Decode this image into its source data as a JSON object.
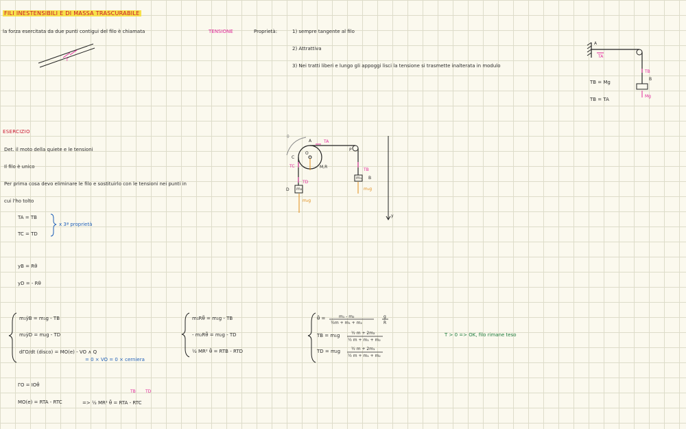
{
  "title": "FILI INESTENSIBILI E DI MASSA TRASCURABILE",
  "intro": {
    "text": "la forza esercitata da due punti contigui del filo è chiamata",
    "keyword": "TENSIONE",
    "props_label": "Proprietà:",
    "props": [
      "1) sempre tangente al filo",
      "2) Attrattiva",
      "3) Nei tratti liberi e lungo gli appoggi lisci la tensione si trasmette inalterata in modulo"
    ]
  },
  "diagram1": {
    "t": "T"
  },
  "diagram2": {
    "A": "A",
    "TA": "TA",
    "TB": "TB",
    "B": "B",
    "Mg": "Mg",
    "eq1": "TB = Mg",
    "eq2": "TB = TA"
  },
  "exercise": {
    "title": "ESERCIZIO",
    "lines": [
      "Det. il moto della quiete e le tensioni",
      "Il filo è unico",
      "Per prima cosa devo eliminare le filo e sostituirlo con le tensioni nei punti in",
      "cui l'ho tolto"
    ],
    "eqs": [
      "TA = TB",
      "TC = TD"
    ],
    "note": "x 3ª proprietà",
    "yb": "yB = Rθ",
    "yd": "yD = - Rθ"
  },
  "diagram3": {
    "A": "A",
    "C": "C",
    "O": "O",
    "P": "P",
    "D": "D",
    "B": "B",
    "TA": "TA",
    "TC": "TC",
    "TB": "TB",
    "TD": "TD",
    "MR": "M,R",
    "m1": "m₁",
    "m2": "m₂",
    "m1g": "m₁g",
    "m2g": "m₂g",
    "y": "y",
    "theta": "θ"
  },
  "system1": [
    "m₁ÿB = m₁g - TB",
    "m₂ÿD = m₂g - TD",
    "dΓO/dt (disco) = MO(e) - VO ∧ Q",
    "= 0 × VO = 0 × cerniera"
  ],
  "system2": [
    "m₁Rθ̈ = m₁g - TB",
    "- m₂Rθ̈ = m₂g - TD",
    "½ MR² θ̈ = RTB - RTD"
  ],
  "system3": {
    "r1_lhs": "θ̈ =",
    "r1_num": "m₁ - m₂",
    "r1_den": "½m + m₁ + m₂",
    "r1_g": "g",
    "r1_R": "R",
    "r2_lhs": "TB = m₁g",
    "r2_num": "½ m + 2m₂",
    "r2_den": "½ m + m₁ + m₂",
    "r3_lhs": "TD = m₂g",
    "r3_num": "½ m + 2m₁",
    "r3_den": "½ m + m₁ + m₂"
  },
  "conclusion": "T > 0 => OK, filo rimane teso",
  "bottom": {
    "l1": "ΓO = IOθ̇",
    "l2": "MO(e) = RTA - RTC",
    "l3": "=> ½ MR² θ̈ = RTA - RTC",
    "tb": "TB",
    "td": "TD"
  }
}
